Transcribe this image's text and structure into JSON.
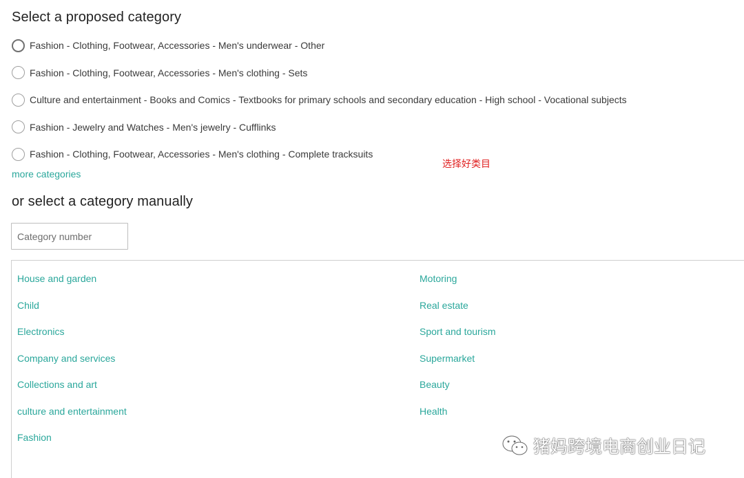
{
  "proposed": {
    "title": "Select a proposed category",
    "options": [
      "Fashion - Clothing, Footwear, Accessories - Men's underwear - Other",
      "Fashion - Clothing, Footwear, Accessories - Men's clothing - Sets",
      "Culture and entertainment - Books and Comics - Textbooks for primary schools and secondary education - High school - Vocational subjects",
      "Fashion - Jewelry and Watches - Men's jewelry - Cufflinks",
      "Fashion - Clothing, Footwear, Accessories - Men's clothing - Complete tracksuits"
    ],
    "more_link": "more categories"
  },
  "annotation": "选择好类目",
  "manual": {
    "title": "or select a category manually",
    "input_placeholder": "Category number",
    "left_categories": [
      "House and garden",
      "Child",
      "Electronics",
      "Company and services",
      "Collections and art",
      "culture and entertainment",
      "Fashion"
    ],
    "right_categories": [
      "Motoring",
      "Real estate",
      "Sport and tourism",
      "Supermarket",
      "Beauty",
      "Health"
    ]
  },
  "watermark": {
    "icon": "wechat-icon",
    "text": "猪妈跨境电商创业日记"
  },
  "colors": {
    "link": "#2aa79b",
    "annotation": "#e02020"
  }
}
